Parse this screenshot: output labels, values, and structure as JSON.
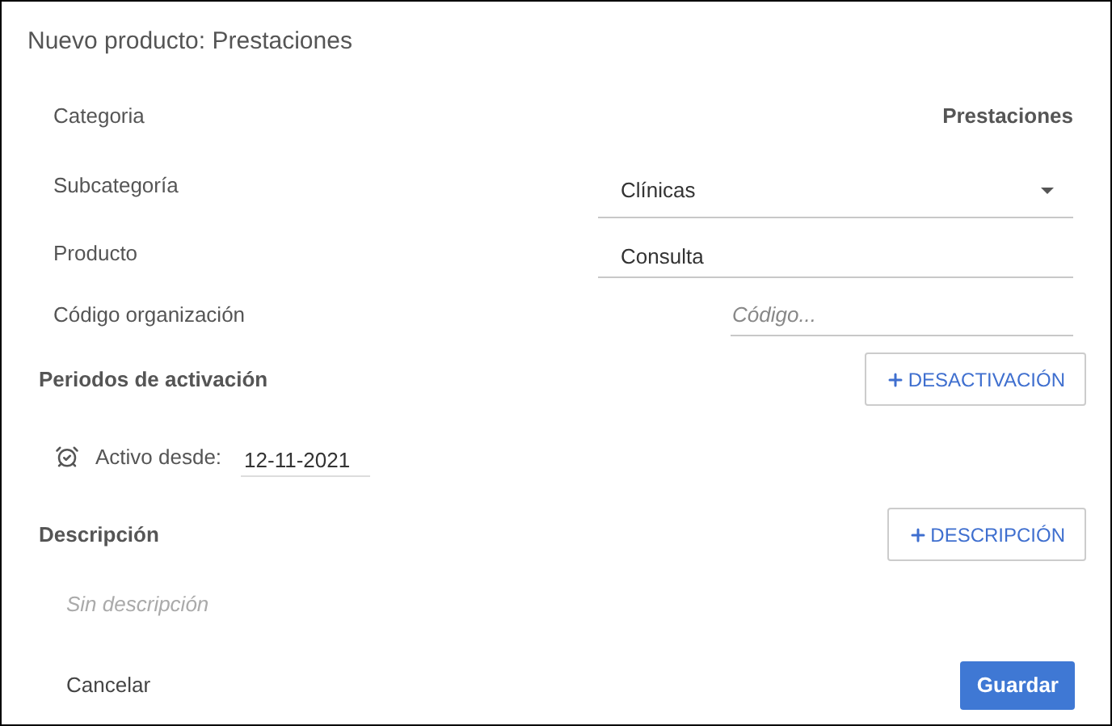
{
  "dialog": {
    "title": "Nuevo producto: Prestaciones"
  },
  "fields": [
    {
      "kind": "static",
      "label": "Categoria",
      "value": "Prestaciones"
    },
    {
      "kind": "select",
      "label": "Subcategoría",
      "value": "Clínicas"
    },
    {
      "kind": "text",
      "label": "Producto",
      "value": "Consulta"
    },
    {
      "kind": "input",
      "label": "Código organización",
      "placeholder": "Código..."
    }
  ],
  "activation": {
    "heading": "Periodos de activación",
    "button": "DESACTIVACIÓN",
    "active_from_label": "Activo desde:",
    "active_from": "12-11-2021"
  },
  "description": {
    "heading": "Descripción",
    "button": "DESCRIPCIÓN",
    "empty_text": "Sin descripción"
  },
  "buttons": {
    "cancel": "Cancelar",
    "save": "Guardar"
  }
}
